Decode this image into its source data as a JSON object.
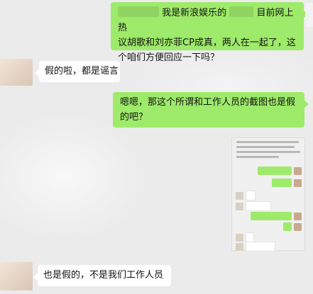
{
  "chat": {
    "messages": [
      {
        "side": "right",
        "line1_mid": "我是新浪娱乐的",
        "line1_end": "目前网上热",
        "line2": "议胡歌和刘亦菲CP成真，两人在一起了，这",
        "line3": "个咱们方便回应一下吗？"
      },
      {
        "side": "left",
        "text": "假的啦，都是谣言"
      },
      {
        "side": "right",
        "line1": "嗯嗯，那这个所谓和工作人员的截图也是假",
        "line2": "的吧？"
      },
      {
        "side": "right",
        "type": "image",
        "text": "",
        "image_label": "screenshot-of-chat"
      },
      {
        "side": "left",
        "text": "也是假的，不是我们工作人员"
      }
    ]
  },
  "colors": {
    "background": "#ebebeb",
    "bubble_right": "#9eea6a",
    "bubble_left": "#ffffff"
  }
}
